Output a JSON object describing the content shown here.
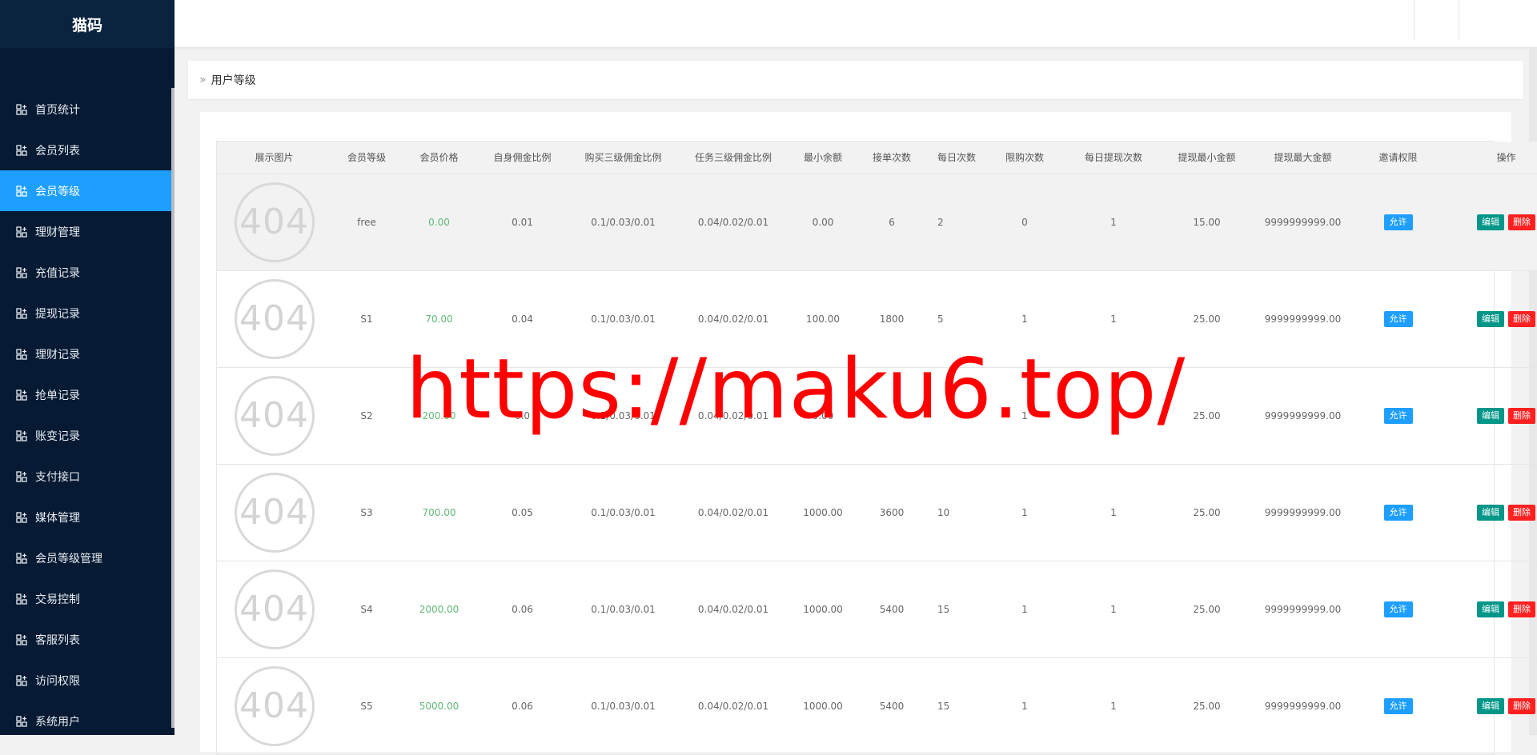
{
  "app": {
    "logo": "猫码"
  },
  "sidebar": {
    "items": [
      {
        "label": "首页统计",
        "active": false
      },
      {
        "label": "会员列表",
        "active": false
      },
      {
        "label": "会员等级",
        "active": true
      },
      {
        "label": "理财管理",
        "active": false
      },
      {
        "label": "充值记录",
        "active": false
      },
      {
        "label": "提现记录",
        "active": false
      },
      {
        "label": "理财记录",
        "active": false
      },
      {
        "label": "抢单记录",
        "active": false
      },
      {
        "label": "账变记录",
        "active": false
      },
      {
        "label": "支付接口",
        "active": false
      },
      {
        "label": "媒体管理",
        "active": false
      },
      {
        "label": "会员等级管理",
        "active": false
      },
      {
        "label": "交易控制",
        "active": false
      },
      {
        "label": "客服列表",
        "active": false
      },
      {
        "label": "访问权限",
        "active": false
      },
      {
        "label": "系统用户",
        "active": false
      }
    ]
  },
  "breadcrumb": {
    "arrow": "»",
    "current": "用户等级"
  },
  "table": {
    "headers": [
      "展示图片",
      "会员等级",
      "会员价格",
      "自身佣金比例",
      "购买三级佣金比例",
      "任务三级佣金比例",
      "最小余额",
      "接单次数",
      "每日次数",
      "限购次数",
      "每日提现次数",
      "提现最小金额",
      "提现最大金额",
      "邀请权限",
      "操作"
    ],
    "image_placeholder": "404",
    "allow_label": "允许",
    "edit_label": "编辑",
    "delete_label": "删除",
    "rows": [
      {
        "level": "free",
        "price": "0.00",
        "self_ratio": "0.01",
        "buy_ratio": "0.1/0.03/0.01",
        "task_ratio": "0.04/0.02/0.01",
        "min_balance": "0.00",
        "orders": "6",
        "daily": "2",
        "limit": "0",
        "daily_withdraw": "1",
        "withdraw_min": "15.00",
        "withdraw_max": "9999999999.00"
      },
      {
        "level": "S1",
        "price": "70.00",
        "self_ratio": "0.04",
        "buy_ratio": "0.1/0.03/0.01",
        "task_ratio": "0.04/0.02/0.01",
        "min_balance": "100.00",
        "orders": "1800",
        "daily": "5",
        "limit": "1",
        "daily_withdraw": "1",
        "withdraw_min": "25.00",
        "withdraw_max": "9999999999.00"
      },
      {
        "level": "S2",
        "price": "200.00",
        "self_ratio": "0.0",
        "buy_ratio": "0.1/0.03/0.01",
        "task_ratio": "0.04/0.02/0.01",
        "min_balance": "0.00",
        "orders": "",
        "daily": "",
        "limit": "1",
        "daily_withdraw": "1",
        "withdraw_min": "25.00",
        "withdraw_max": "9999999999.00"
      },
      {
        "level": "S3",
        "price": "700.00",
        "self_ratio": "0.05",
        "buy_ratio": "0.1/0.03/0.01",
        "task_ratio": "0.04/0.02/0.01",
        "min_balance": "1000.00",
        "orders": "3600",
        "daily": "10",
        "limit": "1",
        "daily_withdraw": "1",
        "withdraw_min": "25.00",
        "withdraw_max": "9999999999.00"
      },
      {
        "level": "S4",
        "price": "2000.00",
        "self_ratio": "0.06",
        "buy_ratio": "0.1/0.03/0.01",
        "task_ratio": "0.04/0.02/0.01",
        "min_balance": "1000.00",
        "orders": "5400",
        "daily": "15",
        "limit": "1",
        "daily_withdraw": "1",
        "withdraw_min": "25.00",
        "withdraw_max": "9999999999.00"
      },
      {
        "level": "S5",
        "price": "5000.00",
        "self_ratio": "0.06",
        "buy_ratio": "0.1/0.03/0.01",
        "task_ratio": "0.04/0.02/0.01",
        "min_balance": "1000.00",
        "orders": "5400",
        "daily": "15",
        "limit": "1",
        "daily_withdraw": "1",
        "withdraw_min": "25.00",
        "withdraw_max": "9999999999.00"
      }
    ]
  },
  "watermark": "https://maku6.top/",
  "colors": {
    "sidebar_bg": "#061a33",
    "active_item": "#1e9fff",
    "price_green": "#5fb878",
    "edit_teal": "#009688",
    "delete_red": "#ff2020",
    "watermark_red": "#ff0000"
  }
}
